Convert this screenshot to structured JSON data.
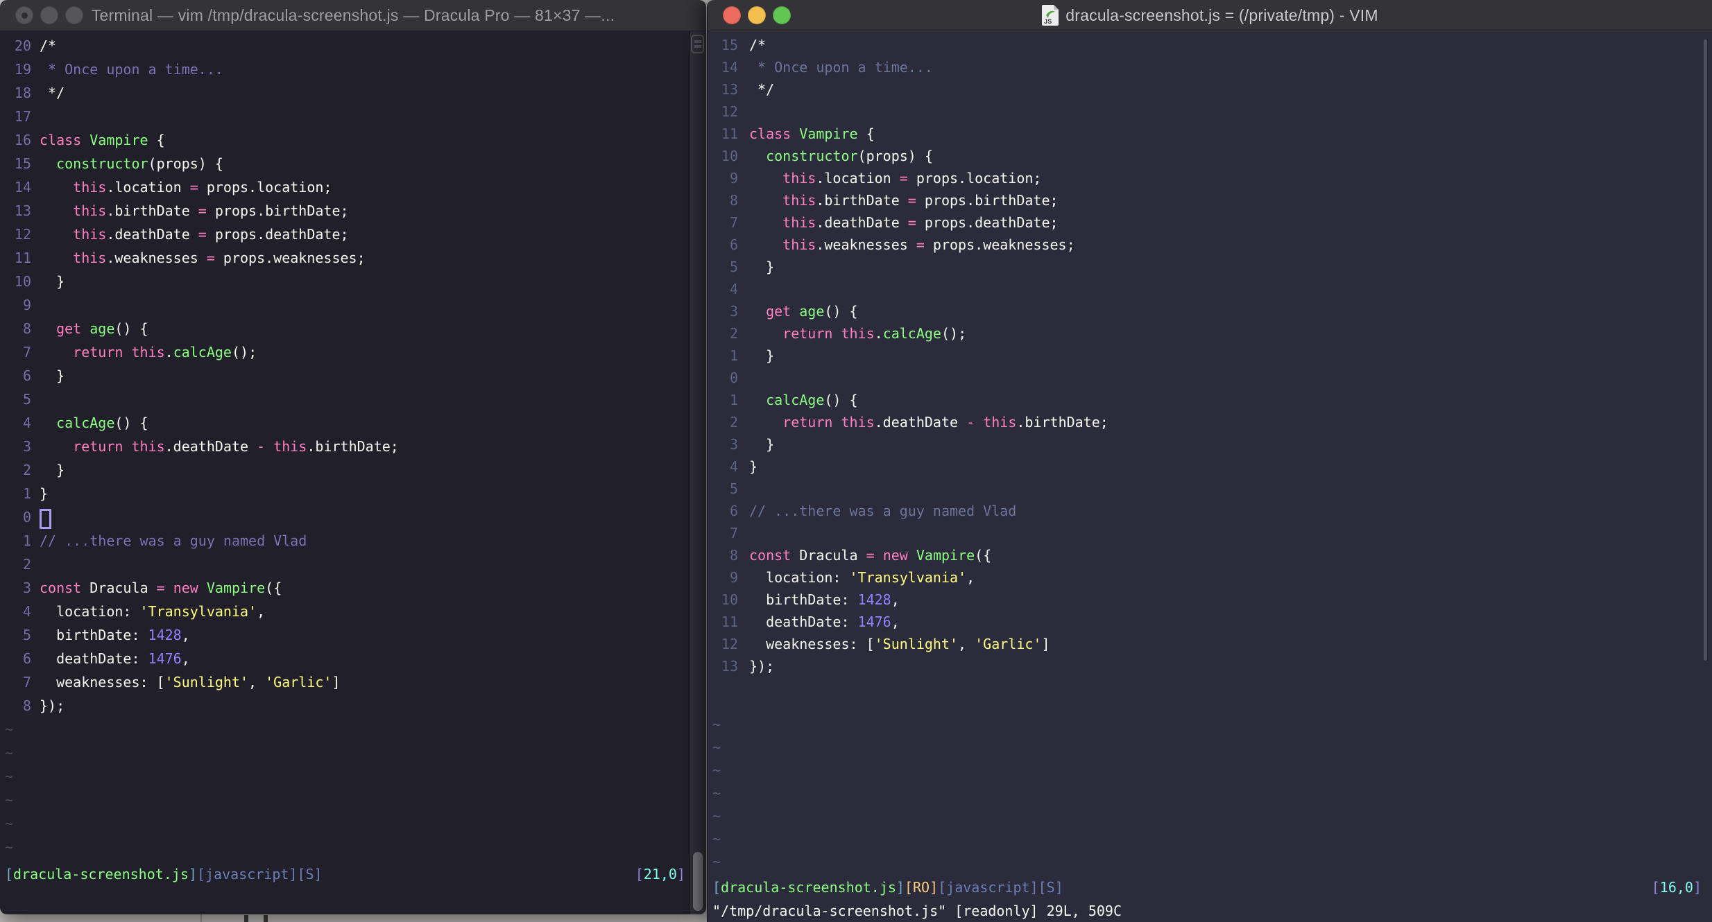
{
  "palette": {
    "left_background": "#201F2A",
    "right_background": "#2B2B3C",
    "titlebar": "#343338",
    "foreground": "#F8F8F2",
    "pink": "#FF80BF",
    "green": "#8AFF80",
    "yellow": "#FFFF80",
    "purple": "#9580FF",
    "cyan": "#80FFEA",
    "orange": "#FFCA80",
    "comment_left": "#7B72B4",
    "comment_right": "#6E7499"
  },
  "left_window": {
    "title": "Terminal — vim /tmp/dracula-screenshot.js — Dracula Pro — 81×37 —...",
    "tilde": "~",
    "tilde_count": 6,
    "lines": [
      {
        "num": "20",
        "segs": [
          [
            "fg",
            "/*"
          ]
        ]
      },
      {
        "num": "19",
        "segs": [
          [
            "comment",
            " * Once upon a time..."
          ]
        ]
      },
      {
        "num": "18",
        "segs": [
          [
            "fg",
            " */"
          ]
        ]
      },
      {
        "num": "17",
        "segs": []
      },
      {
        "num": "16",
        "segs": [
          [
            "pink",
            "class"
          ],
          [
            "fg",
            " "
          ],
          [
            "green",
            "Vampire"
          ],
          [
            "fg",
            " {"
          ]
        ]
      },
      {
        "num": "15",
        "segs": [
          [
            "fg",
            "  "
          ],
          [
            "green",
            "constructor"
          ],
          [
            "fg",
            "(props) {"
          ]
        ]
      },
      {
        "num": "14",
        "segs": [
          [
            "fg",
            "    "
          ],
          [
            "pink",
            "this"
          ],
          [
            "fg",
            ".location "
          ],
          [
            "pink",
            "="
          ],
          [
            "fg",
            " props.location;"
          ]
        ]
      },
      {
        "num": "13",
        "segs": [
          [
            "fg",
            "    "
          ],
          [
            "pink",
            "this"
          ],
          [
            "fg",
            ".birthDate "
          ],
          [
            "pink",
            "="
          ],
          [
            "fg",
            " props.birthDate;"
          ]
        ]
      },
      {
        "num": "12",
        "segs": [
          [
            "fg",
            "    "
          ],
          [
            "pink",
            "this"
          ],
          [
            "fg",
            ".deathDate "
          ],
          [
            "pink",
            "="
          ],
          [
            "fg",
            " props.deathDate;"
          ]
        ]
      },
      {
        "num": "11",
        "segs": [
          [
            "fg",
            "    "
          ],
          [
            "pink",
            "this"
          ],
          [
            "fg",
            ".weaknesses "
          ],
          [
            "pink",
            "="
          ],
          [
            "fg",
            " props.weaknesses;"
          ]
        ]
      },
      {
        "num": "10",
        "segs": [
          [
            "fg",
            "  }"
          ]
        ]
      },
      {
        "num": "9",
        "segs": []
      },
      {
        "num": "8",
        "segs": [
          [
            "fg",
            "  "
          ],
          [
            "pink",
            "get"
          ],
          [
            "fg",
            " "
          ],
          [
            "green",
            "age"
          ],
          [
            "fg",
            "() {"
          ]
        ]
      },
      {
        "num": "7",
        "segs": [
          [
            "fg",
            "    "
          ],
          [
            "pink",
            "return"
          ],
          [
            "fg",
            " "
          ],
          [
            "pink",
            "this"
          ],
          [
            "fg",
            "."
          ],
          [
            "green",
            "calcAge"
          ],
          [
            "fg",
            "();"
          ]
        ]
      },
      {
        "num": "6",
        "segs": [
          [
            "fg",
            "  }"
          ]
        ]
      },
      {
        "num": "5",
        "segs": []
      },
      {
        "num": "4",
        "segs": [
          [
            "fg",
            "  "
          ],
          [
            "green",
            "calcAge"
          ],
          [
            "fg",
            "() {"
          ]
        ]
      },
      {
        "num": "3",
        "segs": [
          [
            "fg",
            "    "
          ],
          [
            "pink",
            "return"
          ],
          [
            "fg",
            " "
          ],
          [
            "pink",
            "this"
          ],
          [
            "fg",
            ".deathDate "
          ],
          [
            "pink",
            "-"
          ],
          [
            "fg",
            " "
          ],
          [
            "pink",
            "this"
          ],
          [
            "fg",
            ".birthDate;"
          ]
        ]
      },
      {
        "num": "2",
        "segs": [
          [
            "fg",
            "  }"
          ]
        ]
      },
      {
        "num": "1",
        "segs": [
          [
            "fg",
            "}"
          ]
        ]
      },
      {
        "num": "0",
        "segs": [],
        "cursor": true
      },
      {
        "num": "1",
        "segs": [
          [
            "comment",
            "// ...there was a guy named Vlad"
          ]
        ]
      },
      {
        "num": "2",
        "segs": []
      },
      {
        "num": "3",
        "segs": [
          [
            "pink",
            "const"
          ],
          [
            "fg",
            " Dracula "
          ],
          [
            "pink",
            "="
          ],
          [
            "fg",
            " "
          ],
          [
            "pink",
            "new"
          ],
          [
            "fg",
            " "
          ],
          [
            "green",
            "Vampire"
          ],
          [
            "fg",
            "({"
          ]
        ]
      },
      {
        "num": "4",
        "segs": [
          [
            "fg",
            "  location: "
          ],
          [
            "yellow",
            "'Transylvania'"
          ],
          [
            "fg",
            ","
          ]
        ]
      },
      {
        "num": "5",
        "segs": [
          [
            "fg",
            "  birthDate: "
          ],
          [
            "purple",
            "1428"
          ],
          [
            "fg",
            ","
          ]
        ]
      },
      {
        "num": "6",
        "segs": [
          [
            "fg",
            "  deathDate: "
          ],
          [
            "purple",
            "1476"
          ],
          [
            "fg",
            ","
          ]
        ]
      },
      {
        "num": "7",
        "segs": [
          [
            "fg",
            "  weaknesses: ["
          ],
          [
            "yellow",
            "'Sunlight'"
          ],
          [
            "fg",
            ", "
          ],
          [
            "yellow",
            "'Garlic'"
          ],
          [
            "fg",
            "]"
          ]
        ]
      },
      {
        "num": "8",
        "segs": [
          [
            "fg",
            "});"
          ]
        ]
      }
    ],
    "status_left": [
      [
        "cybrkt",
        "["
      ],
      [
        "green",
        "dracula-screenshot.js"
      ],
      [
        "cybrkt",
        "]"
      ],
      [
        "slate",
        "[javascript][S]"
      ]
    ],
    "status_right": [
      [
        "pbrkt",
        "["
      ],
      [
        "cyan",
        "21,0"
      ],
      [
        "pbrkt",
        "]"
      ]
    ]
  },
  "right_window": {
    "title": "dracula-screenshot.js = (/private/tmp) - VIM",
    "doc_icon_text": "JS",
    "tilde": "~",
    "tilde_count": 7,
    "lines": [
      {
        "num": "15",
        "segs": [
          [
            "fg",
            "/*"
          ]
        ]
      },
      {
        "num": "14",
        "segs": [
          [
            "comment",
            " * Once upon a time..."
          ]
        ]
      },
      {
        "num": "13",
        "segs": [
          [
            "fg",
            " */"
          ]
        ]
      },
      {
        "num": "12",
        "segs": []
      },
      {
        "num": "11",
        "segs": [
          [
            "pink",
            "class"
          ],
          [
            "fg",
            " "
          ],
          [
            "green",
            "Vampire"
          ],
          [
            "fg",
            " {"
          ]
        ]
      },
      {
        "num": "10",
        "segs": [
          [
            "fg",
            "  "
          ],
          [
            "green",
            "constructor"
          ],
          [
            "fg",
            "(props) {"
          ]
        ]
      },
      {
        "num": "9",
        "segs": [
          [
            "fg",
            "    "
          ],
          [
            "pink",
            "this"
          ],
          [
            "fg",
            ".location "
          ],
          [
            "pink",
            "="
          ],
          [
            "fg",
            " props.location;"
          ]
        ]
      },
      {
        "num": "8",
        "segs": [
          [
            "fg",
            "    "
          ],
          [
            "pink",
            "this"
          ],
          [
            "fg",
            ".birthDate "
          ],
          [
            "pink",
            "="
          ],
          [
            "fg",
            " props.birthDate;"
          ]
        ]
      },
      {
        "num": "7",
        "segs": [
          [
            "fg",
            "    "
          ],
          [
            "pink",
            "this"
          ],
          [
            "fg",
            ".deathDate "
          ],
          [
            "pink",
            "="
          ],
          [
            "fg",
            " props.deathDate;"
          ]
        ]
      },
      {
        "num": "6",
        "segs": [
          [
            "fg",
            "    "
          ],
          [
            "pink",
            "this"
          ],
          [
            "fg",
            ".weaknesses "
          ],
          [
            "pink",
            "="
          ],
          [
            "fg",
            " props.weaknesses;"
          ]
        ]
      },
      {
        "num": "5",
        "segs": [
          [
            "fg",
            "  }"
          ]
        ]
      },
      {
        "num": "4",
        "segs": []
      },
      {
        "num": "3",
        "segs": [
          [
            "fg",
            "  "
          ],
          [
            "pink",
            "get"
          ],
          [
            "fg",
            " "
          ],
          [
            "green",
            "age"
          ],
          [
            "fg",
            "() {"
          ]
        ]
      },
      {
        "num": "2",
        "segs": [
          [
            "fg",
            "    "
          ],
          [
            "pink",
            "return"
          ],
          [
            "fg",
            " "
          ],
          [
            "pink",
            "this"
          ],
          [
            "fg",
            "."
          ],
          [
            "green",
            "calcAge"
          ],
          [
            "fg",
            "();"
          ]
        ]
      },
      {
        "num": "1",
        "segs": [
          [
            "fg",
            "  }"
          ]
        ]
      },
      {
        "num": "0",
        "segs": []
      },
      {
        "num": "1",
        "segs": [
          [
            "fg",
            "  "
          ],
          [
            "green",
            "calcAge"
          ],
          [
            "fg",
            "() {"
          ]
        ]
      },
      {
        "num": "2",
        "segs": [
          [
            "fg",
            "    "
          ],
          [
            "pink",
            "return"
          ],
          [
            "fg",
            " "
          ],
          [
            "pink",
            "this"
          ],
          [
            "fg",
            ".deathDate "
          ],
          [
            "pink",
            "-"
          ],
          [
            "fg",
            " "
          ],
          [
            "pink",
            "this"
          ],
          [
            "fg",
            ".birthDate;"
          ]
        ]
      },
      {
        "num": "3",
        "segs": [
          [
            "fg",
            "  }"
          ]
        ]
      },
      {
        "num": "4",
        "segs": [
          [
            "fg",
            "}"
          ]
        ]
      },
      {
        "num": "5",
        "segs": []
      },
      {
        "num": "6",
        "segs": [
          [
            "comment",
            "// ...there was a guy named Vlad"
          ]
        ]
      },
      {
        "num": "7",
        "segs": []
      },
      {
        "num": "8",
        "segs": [
          [
            "pink",
            "const"
          ],
          [
            "fg",
            " Dracula "
          ],
          [
            "pink",
            "="
          ],
          [
            "fg",
            " "
          ],
          [
            "pink",
            "new"
          ],
          [
            "fg",
            " "
          ],
          [
            "green",
            "Vampire"
          ],
          [
            "fg",
            "({"
          ]
        ]
      },
      {
        "num": "9",
        "segs": [
          [
            "fg",
            "  location: "
          ],
          [
            "yellow",
            "'Transylvania'"
          ],
          [
            "fg",
            ","
          ]
        ]
      },
      {
        "num": "10",
        "segs": [
          [
            "fg",
            "  birthDate: "
          ],
          [
            "purple",
            "1428"
          ],
          [
            "fg",
            ","
          ]
        ]
      },
      {
        "num": "11",
        "segs": [
          [
            "fg",
            "  deathDate: "
          ],
          [
            "purple",
            "1476"
          ],
          [
            "fg",
            ","
          ]
        ]
      },
      {
        "num": "12",
        "segs": [
          [
            "fg",
            "  weaknesses: ["
          ],
          [
            "yellow",
            "'Sunlight'"
          ],
          [
            "fg",
            ", "
          ],
          [
            "yellow",
            "'Garlic'"
          ],
          [
            "fg",
            "]"
          ]
        ]
      },
      {
        "num": "13",
        "segs": [
          [
            "fg",
            "});"
          ]
        ]
      }
    ],
    "status_left": [
      [
        "cybrkt",
        "["
      ],
      [
        "green",
        "dracula-screenshot.js"
      ],
      [
        "cybrkt",
        "]"
      ],
      [
        "orange",
        "[RO]"
      ],
      [
        "slate",
        "[javascript][S]"
      ]
    ],
    "status_right": [
      [
        "pbrkt",
        "["
      ],
      [
        "cyan",
        "16,0"
      ],
      [
        "pbrkt",
        "]"
      ]
    ],
    "command_line": "\"/tmp/dracula-screenshot.js\" [readonly] 29L, 509C"
  }
}
